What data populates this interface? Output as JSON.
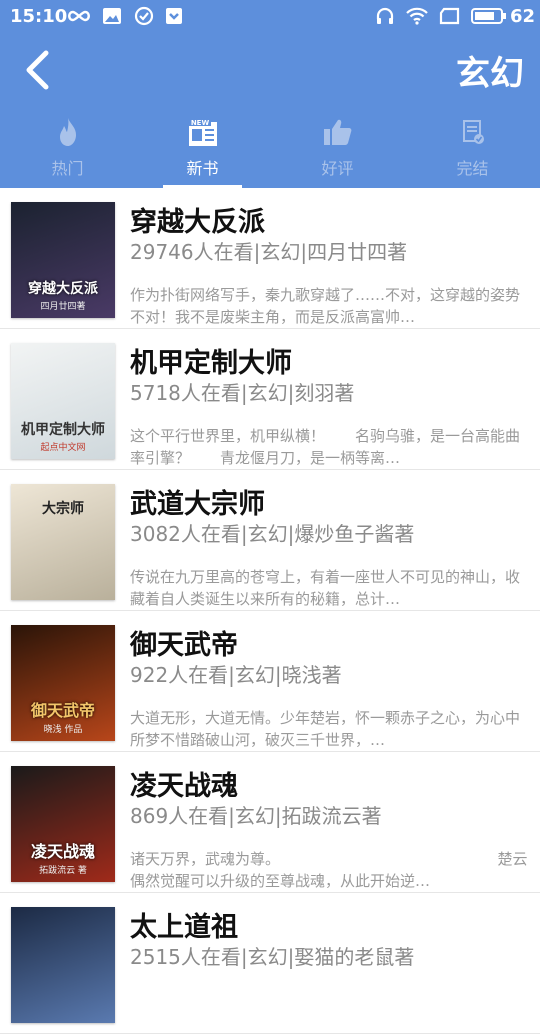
{
  "status": {
    "time": "15:10",
    "battery": "62"
  },
  "nav": {
    "title": "玄幻"
  },
  "tabs": [
    {
      "label": "热门",
      "icon": "flame-icon"
    },
    {
      "label": "新书",
      "icon": "newspaper-new-icon"
    },
    {
      "label": "好评",
      "icon": "thumbs-up-icon"
    },
    {
      "label": "完结",
      "icon": "document-check-icon"
    }
  ],
  "books": [
    {
      "title": "穿越大反派",
      "meta": "29746人在看|玄幻|四月廿四著",
      "desc": "作为扑街网络写手，秦九歌穿越了……不对，这穿越的姿势不对！我不是废柴主角，而是反派高富帅…",
      "cover_title": "穿越大反派",
      "cover_sub": "四月廿四著",
      "cover_colors": [
        "#1b2230",
        "#4a3a66"
      ]
    },
    {
      "title": "机甲定制大师",
      "meta": "5718人在看|玄幻|刻羽著",
      "desc": "这个平行世界里，机甲纵横！　　名驹乌骓，是一台高能曲率引擎？　　青龙偃月刀，是一柄等离…",
      "cover_title": "机甲定制大师",
      "cover_sub": "起点中文网",
      "cover_colors": [
        "#f2f4f4",
        "#cfd8dc"
      ]
    },
    {
      "title": "武道大宗师",
      "meta": "3082人在看|玄幻|爆炒鱼子酱著",
      "desc": "传说在九万里高的苍穹上，有着一座世人不可见的神山，收藏着自人类诞生以来所有的秘籍，总计…",
      "cover_title": "大宗师",
      "cover_sub": "",
      "cover_colors": [
        "#eee6d6",
        "#b9b09b"
      ]
    },
    {
      "title": "御天武帝",
      "meta": "922人在看|玄幻|晓浅著",
      "desc": "大道无形，大道无情。少年楚岩，怀一颗赤子之心，为心中所梦不惜踏破山河，破灭三千世界，…",
      "cover_title": "御天武帝",
      "cover_sub": "晓浅 作品",
      "cover_colors": [
        "#2a1408",
        "#b8461a"
      ]
    },
    {
      "title": "凌天战魂",
      "meta": "869人在看|玄幻|拓跋流云著",
      "desc": "诸天万界，武魂为尊。　　　　　　　　　　　　　　　楚云偶然觉醒可以升级的至尊战魂，从此开始逆…",
      "cover_title": "凌天战魂",
      "cover_sub": "拓跋流云 著",
      "cover_colors": [
        "#1a1a1a",
        "#a02a1a"
      ]
    },
    {
      "title": "太上道祖",
      "meta": "2515人在看|玄幻|娶猫的老鼠著",
      "desc": "",
      "cover_title": "",
      "cover_sub": "",
      "cover_colors": [
        "#1c2a44",
        "#5a7ab0"
      ]
    }
  ]
}
